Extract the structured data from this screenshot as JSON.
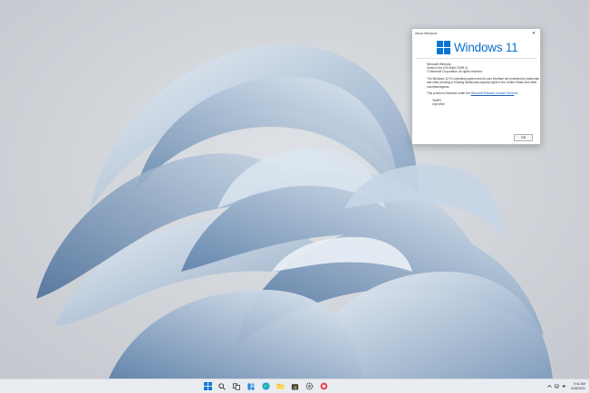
{
  "dialog": {
    "title": "About Windows",
    "close_glyph": "✕",
    "brand": "Windows 11",
    "info_lines": [
      "Microsoft Windows",
      "Version Dev (OS Build 21996.1)",
      "© Microsoft Corporation. All rights reserved."
    ],
    "legal": "The Windows 11 Pro operating system and its user interface are protected by trademark and other pending or existing intellectual property rights in the United States and other countries/regions.",
    "license_prefix": "This product is licensed under the ",
    "license_link": "Microsoft Software License Terms",
    "license_suffix": " to:",
    "user": "TestPC",
    "org": "org name",
    "ok_label": "OK"
  },
  "taskbar": {
    "icons": [
      "start-icon",
      "search-icon",
      "task-view-icon",
      "widgets-icon",
      "edge-icon",
      "file-explorer-icon",
      "store-icon",
      "settings-icon",
      "snipping-icon"
    ],
    "tray_icons": [
      "chevron-up-icon",
      "network-icon",
      "volume-icon"
    ],
    "clock": {
      "time": "9:41 AM",
      "date": "6/16/2021"
    }
  },
  "colors": {
    "accent": "#0a74d6",
    "taskbar": "#e9edf2"
  }
}
